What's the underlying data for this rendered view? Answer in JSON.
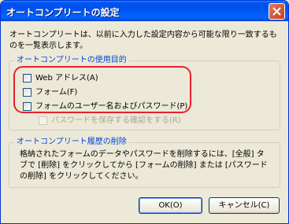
{
  "window": {
    "title": "オートコンプリートの設定"
  },
  "intro": "オートコンプリートは、以前に入力した設定内容から可能な限り一致するものを一覧表示します。",
  "usage_group": {
    "legend": "オートコンプリートの使用目的",
    "items": [
      {
        "label": "Web アドレス(A)",
        "checked": false
      },
      {
        "label": "フォーム(F)",
        "checked": false
      },
      {
        "label": "フォームのユーザー名およびパスワード(P)",
        "checked": false
      }
    ],
    "sub_option": {
      "label": "パスワードを保存する確認をする(R)",
      "checked": false,
      "enabled": false
    }
  },
  "history_group": {
    "legend": "オートコンプリート履歴の削除",
    "text": "格納されたフォームのデータやパスワードを削除するには、[全般] タブで [削除] をクリックしてから [フォームの削除] または [パスワードの削除] をクリックしてください。"
  },
  "buttons": {
    "ok": "OK(O)",
    "cancel": "キャンセル(C)"
  },
  "colors": {
    "title_bar": "#0054e3",
    "annotation": "#e8202e",
    "legend_text": "#0046d5"
  }
}
